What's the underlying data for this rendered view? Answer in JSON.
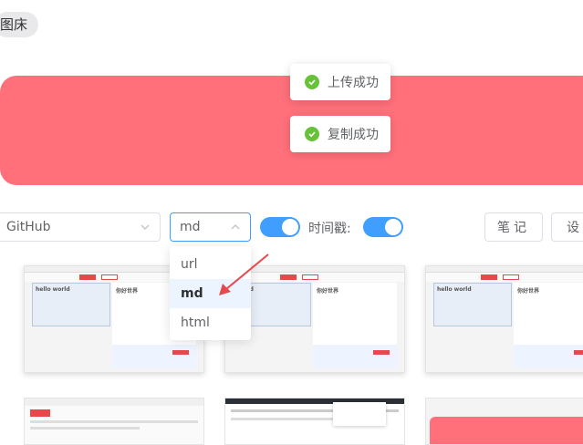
{
  "app": {
    "title": "图床"
  },
  "toasts": [
    {
      "text": "上传成功"
    },
    {
      "text": "复制成功"
    }
  ],
  "toolbar": {
    "storage_select": {
      "value": "GitHub"
    },
    "format_select": {
      "value": "md",
      "options": [
        "url",
        "md",
        "html"
      ]
    },
    "timestamp_label": "时间戳:",
    "notes_button": "笔记",
    "settings_button": "设置"
  },
  "thumbnails": [
    {
      "text": "hello world",
      "title": "你好世界"
    },
    {
      "text": "world",
      "title": "你好世界"
    },
    {
      "text": "hello world",
      "title": "你好世界"
    }
  ],
  "colors": {
    "accent": "#409eff",
    "banner": "#ff707a",
    "success": "#67c23a",
    "arrow": "#e5484d"
  }
}
